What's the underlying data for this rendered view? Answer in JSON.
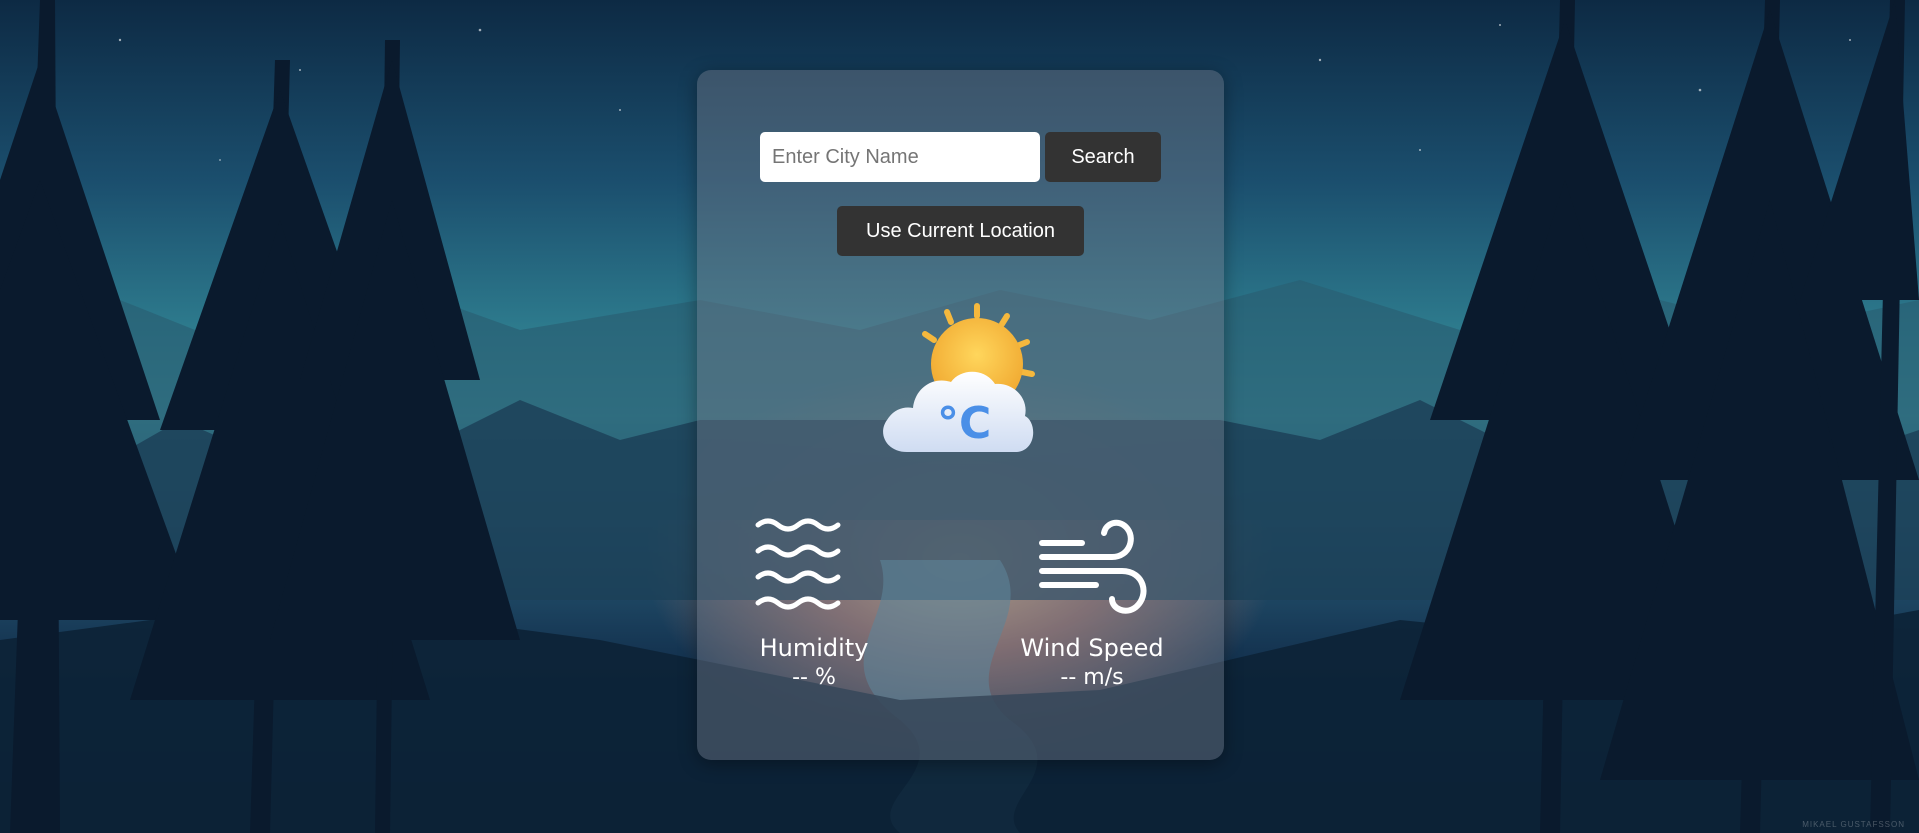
{
  "search": {
    "placeholder": "Enter City Name",
    "value": "",
    "button_label": "Search"
  },
  "location": {
    "button_label": "Use Current Location"
  },
  "weather": {
    "icon": "partly-cloudy-celsius-icon",
    "icon_text": "°C"
  },
  "humidity": {
    "icon": "humidity-waves-icon",
    "label": "Humidity",
    "value": "-- %"
  },
  "wind": {
    "icon": "wind-icon",
    "label": "Wind Speed",
    "value": "-- m/s"
  },
  "credit": "MIKAEL GUSTAFSSON",
  "colors": {
    "button_bg": "#333333",
    "button_text": "#ffffff",
    "card_bg": "rgba(110,120,135,0.45)",
    "sun": "#f5b83d",
    "cloud": "#e8f0fb",
    "celsius": "#4a8fe7"
  }
}
